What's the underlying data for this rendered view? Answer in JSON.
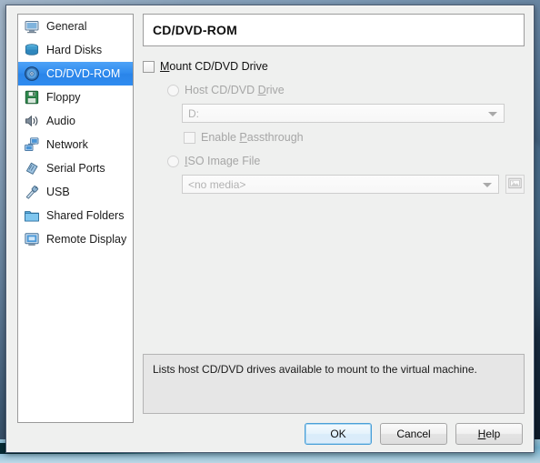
{
  "dialog": {
    "title": "CD/DVD-ROM"
  },
  "sidebar": {
    "items": [
      {
        "label": "General",
        "icon": "monitor-icon",
        "selected": false
      },
      {
        "label": "Hard Disks",
        "icon": "harddisk-icon",
        "selected": false
      },
      {
        "label": "CD/DVD-ROM",
        "icon": "cd-disc-icon",
        "selected": true
      },
      {
        "label": "Floppy",
        "icon": "floppy-disk-icon",
        "selected": false
      },
      {
        "label": "Audio",
        "icon": "speaker-icon",
        "selected": false
      },
      {
        "label": "Network",
        "icon": "network-icon",
        "selected": false
      },
      {
        "label": "Serial Ports",
        "icon": "serial-port-icon",
        "selected": false
      },
      {
        "label": "USB",
        "icon": "usb-plug-icon",
        "selected": false
      },
      {
        "label": "Shared Folders",
        "icon": "folder-icon",
        "selected": false
      },
      {
        "label": "Remote Display",
        "icon": "remote-display-icon",
        "selected": false
      }
    ]
  },
  "settings": {
    "mount_checkbox": {
      "label_before": "M",
      "label_accel": "M",
      "label": "Mount CD/DVD Drive",
      "checked": false,
      "enabled": true
    },
    "host_drive_radio": {
      "label": "Host CD/DVD Drive",
      "selected": false,
      "enabled": false
    },
    "host_drive_combo": {
      "value": "D:",
      "enabled": false
    },
    "passthrough_checkbox": {
      "label": "Enable Passthrough",
      "checked": false,
      "enabled": false
    },
    "iso_radio": {
      "label": "ISO Image File",
      "selected": false,
      "enabled": false
    },
    "iso_combo": {
      "value": "<no media>",
      "enabled": false
    },
    "browse_button": {
      "icon": "select-image-icon",
      "enabled": false
    }
  },
  "info": {
    "text": "Lists host CD/DVD drives available to mount to the virtual machine."
  },
  "buttons": {
    "ok": "OK",
    "cancel": "Cancel",
    "help": "Help"
  },
  "colors": {
    "selection_blue": "#2f8bee",
    "default_button_border": "#4a9fd8",
    "dialog_background": "#eff0ef",
    "info_background": "#e6e6e6"
  }
}
